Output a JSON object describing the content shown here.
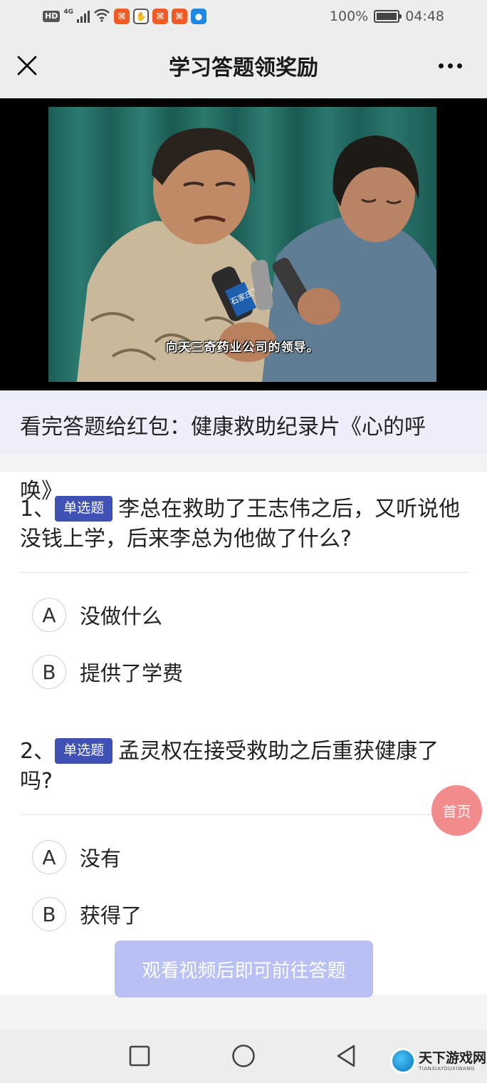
{
  "status_bar": {
    "hd": "HD",
    "network": "4G",
    "battery_percent": "100%",
    "time": "04:48"
  },
  "header": {
    "title": "学习答题领奖励",
    "close_icon": "close-icon",
    "more_icon": "more-dots-icon"
  },
  "video": {
    "subtitle": "向天三奇药业公司的领导。",
    "mic_label": "石家庄TV"
  },
  "banner": {
    "text_line1": "看完答题给红包：健康救助纪录片《心的呼",
    "text_line2": "唤》"
  },
  "questions": [
    {
      "number": "1、",
      "type_badge": "单选题",
      "text": "李总在救助了王志伟之后，又听说他没钱上学，后来李总为他做了什么?",
      "options": [
        {
          "letter": "A",
          "text": "没做什么"
        },
        {
          "letter": "B",
          "text": "提供了学费"
        }
      ]
    },
    {
      "number": "2、",
      "type_badge": "单选题",
      "text": "孟灵权在接受救助之后重获健康了吗?",
      "options": [
        {
          "letter": "A",
          "text": "没有"
        },
        {
          "letter": "B",
          "text": "获得了"
        }
      ]
    }
  ],
  "home_button": "首页",
  "cta_button": "观看视频后即可前往答题",
  "watermark": {
    "title": "天下游戏网",
    "subtitle": "TIANXIAYOUXIWANG"
  },
  "colors": {
    "badge": "#3f51b5",
    "banner_bg": "#eeeefa",
    "cta_bg": "#b9c0f4",
    "home_fab": "#f28c8c"
  }
}
